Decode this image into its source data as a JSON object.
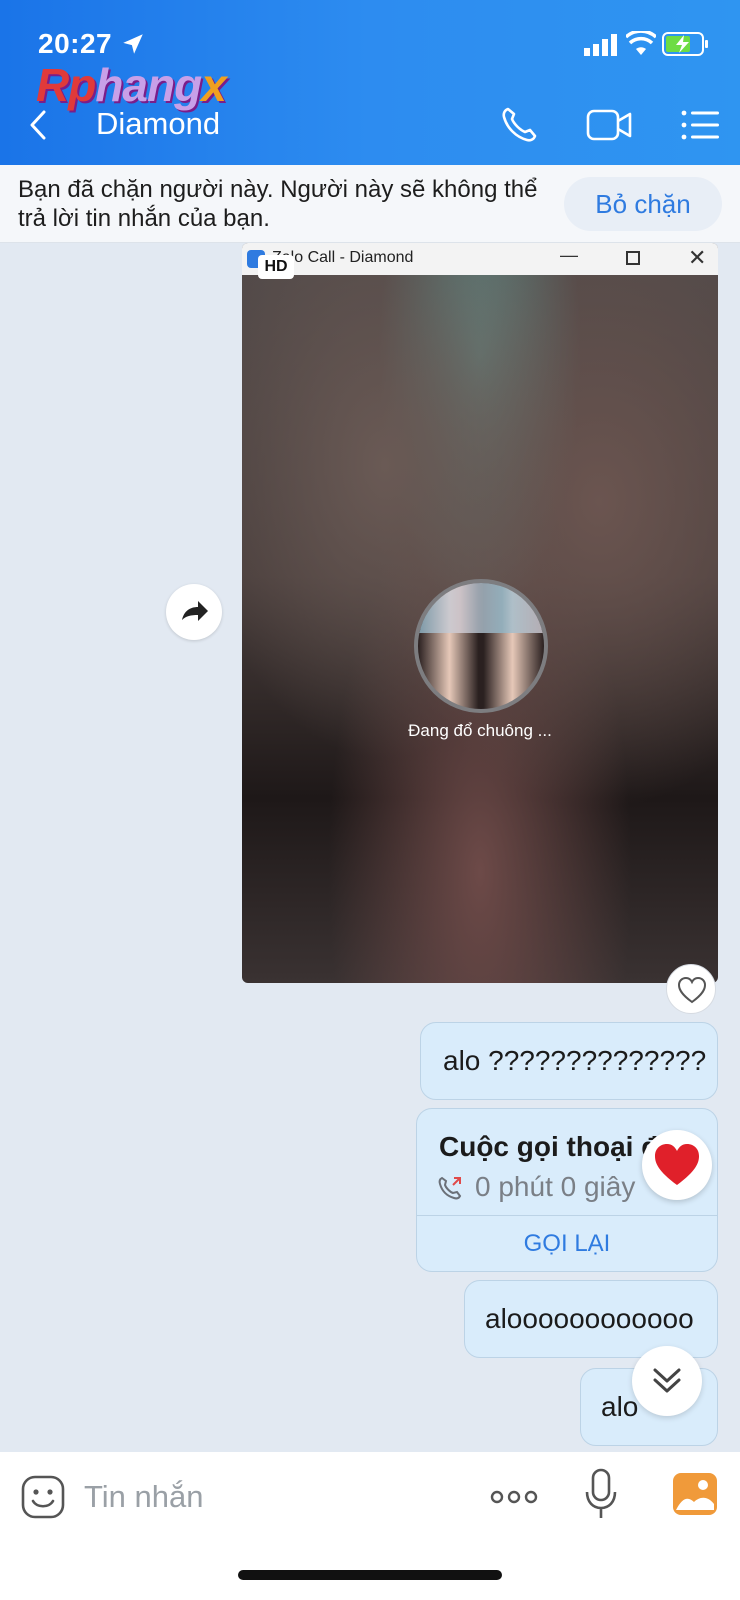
{
  "status_bar": {
    "time": "20:27"
  },
  "logo": {
    "part1": "Rp",
    "part2": "hang",
    "part3": "x"
  },
  "header": {
    "title": "Diamond"
  },
  "banner": {
    "text": "Bạn đã chặn người này. Người này sẽ không thể trả lời tin nhắn của bạn.",
    "unblock_label": "Bỏ chặn"
  },
  "call_window": {
    "title": "Zalo Call - Diamond",
    "hd_label": "HD",
    "status": "Đang đổ chuông ..."
  },
  "messages": [
    {
      "text": "alo ??????????????"
    },
    {
      "text": "aloooooooooooo"
    },
    {
      "text": "alo"
    }
  ],
  "call_card": {
    "title": "Cuộc gọi thoại đi",
    "duration": "0 phút 0 giây",
    "callback_label": "GỌI LẠI"
  },
  "input": {
    "placeholder": "Tin nhắn"
  },
  "colors": {
    "header_blue": "#1a74e8",
    "accent_blue": "#2f7be0",
    "bubble_bg": "#d9ecfb",
    "chat_bg": "#e2e9f2"
  },
  "icons": {
    "header": [
      "back-icon",
      "phone-icon",
      "video-camera-icon",
      "list-menu-icon"
    ],
    "input_bar": [
      "emoji-icon",
      "more-icon",
      "mic-icon",
      "image-icon"
    ]
  }
}
